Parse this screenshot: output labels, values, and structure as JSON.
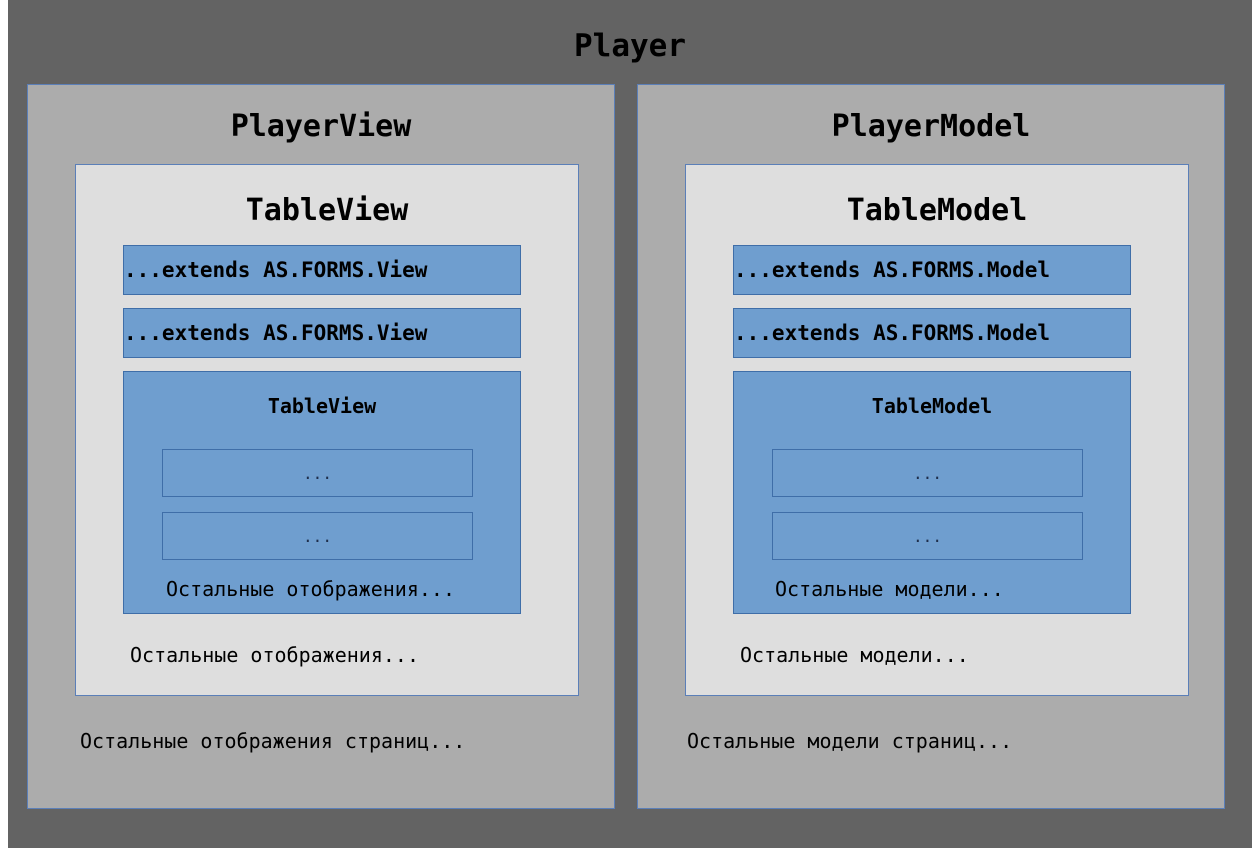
{
  "player": {
    "title": "Player"
  },
  "view": {
    "title": "PlayerView",
    "inner_title": "TableView",
    "bars": [
      "...extends AS.FORMS.View",
      "...extends AS.FORMS.View"
    ],
    "block_title": "TableView",
    "slots": [
      "...",
      "..."
    ],
    "block_rest": "Остальные отображения...",
    "inner_rest": "Остальные отображения...",
    "panel_rest": "Остальные отображения страниц..."
  },
  "model": {
    "title": "PlayerModel",
    "inner_title": "TableModel",
    "bars": [
      "...extends AS.FORMS.Model",
      "...extends AS.FORMS.Model"
    ],
    "block_title": "TableModel",
    "slots": [
      "...",
      "..."
    ],
    "block_rest": "Остальные модели...",
    "inner_rest": "Остальные модели...",
    "panel_rest": "Остальные модели страниц..."
  },
  "colors": {
    "outer_bg": "#636363",
    "panel_bg": "#acacac",
    "inner_bg": "#dedede",
    "block_blue": "#6f9ecf",
    "border_blue": "#5b7fb8"
  }
}
